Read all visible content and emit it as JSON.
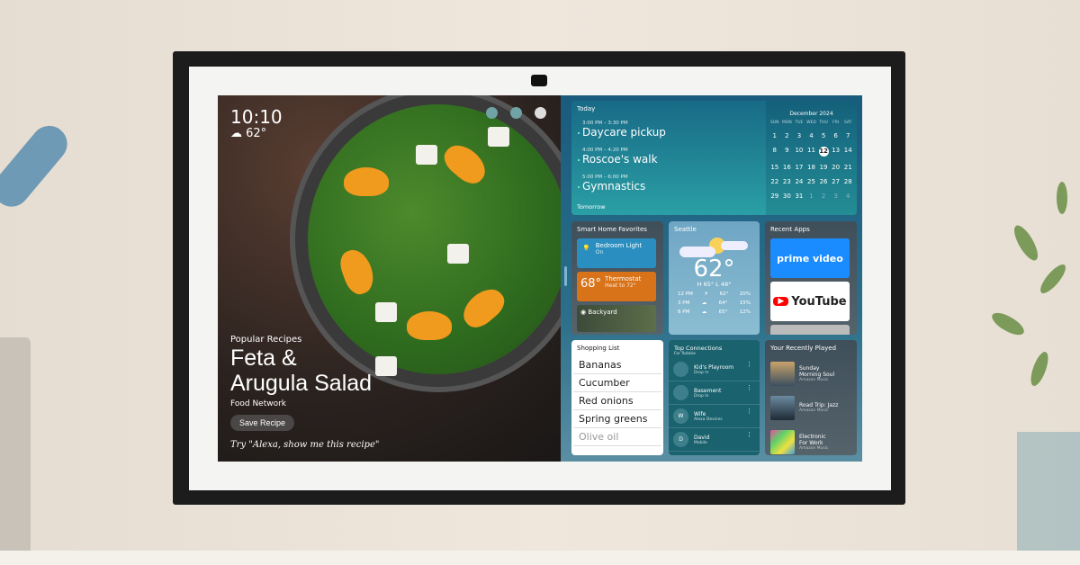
{
  "status": {
    "time": "10:10",
    "temp": "62°",
    "notification_count": "1"
  },
  "recipe": {
    "category": "Popular Recipes",
    "title_line1": "Feta &",
    "title_line2": "Arugula Salad",
    "source": "Food Network",
    "save_label": "Save Recipe",
    "hint": "Try \"Alexa, show me this recipe\""
  },
  "calendar": {
    "today_label": "Today",
    "tomorrow_label": "Tomorrow",
    "events": [
      {
        "time": "3:00 PM – 3:30 PM",
        "name": "Daycare pickup"
      },
      {
        "time": "4:00 PM – 4:20 PM",
        "name": "Roscoe's walk"
      },
      {
        "time": "5:00 PM – 6:00 PM",
        "name": "Gymnastics"
      }
    ],
    "month": "December 2024",
    "weekdays": [
      "SUN",
      "MON",
      "TUE",
      "WED",
      "THU",
      "FRI",
      "SAT"
    ],
    "days": [
      "1",
      "2",
      "3",
      "4",
      "5",
      "6",
      "7",
      "8",
      "9",
      "10",
      "11",
      "12",
      "13",
      "14",
      "15",
      "16",
      "17",
      "18",
      "19",
      "20",
      "21",
      "22",
      "23",
      "24",
      "25",
      "26",
      "27",
      "28",
      "29",
      "30",
      "31",
      "1",
      "2",
      "3",
      "4"
    ],
    "today": "12"
  },
  "smart_home": {
    "title": "Smart Home Favorites",
    "light": {
      "name": "Bedroom Light",
      "state": "On"
    },
    "thermostat": {
      "temp": "68°",
      "name": "Thermostat",
      "state": "Heat to 72°"
    },
    "camera": {
      "name": "Backyard"
    }
  },
  "weather": {
    "city": "Seattle",
    "temp": "62°",
    "high": "H 65°",
    "low": "L 48°",
    "forecast": [
      {
        "time": "12 PM",
        "icon": "sun-icon",
        "temp": "62°",
        "precip": "20%"
      },
      {
        "time": "3 PM",
        "icon": "cloud-icon",
        "temp": "64°",
        "precip": "15%"
      },
      {
        "time": "6 PM",
        "icon": "cloud-icon",
        "temp": "65°",
        "precip": "12%"
      }
    ]
  },
  "recent_apps": {
    "title": "Recent Apps",
    "apps": [
      "prime video",
      "YouTube"
    ]
  },
  "shopping": {
    "title": "Shopping List",
    "items": [
      "Bananas",
      "Cucumber",
      "Red onions",
      "Spring greens",
      "Olive oil"
    ]
  },
  "connections": {
    "title": "Top Connections",
    "subtitle": "For Robbie",
    "items": [
      {
        "initial": "",
        "name": "Kid's Playroom",
        "sub": "Drop In"
      },
      {
        "initial": "",
        "name": "Basement",
        "sub": "Drop In"
      },
      {
        "initial": "W",
        "name": "Wife",
        "sub": "Alexa Devices"
      },
      {
        "initial": "D",
        "name": "David",
        "sub": "Mobile"
      }
    ]
  },
  "played": {
    "title": "Your Recently Played",
    "items": [
      {
        "name_line1": "Sunday",
        "name_line2": "Morning Soul",
        "sub": "Amazon Music"
      },
      {
        "name_line1": "Road Trip: Jazz",
        "name_line2": "",
        "sub": "Amazon Music"
      },
      {
        "name_line1": "Electronic",
        "name_line2": "For Work",
        "sub": "Amazon Music"
      }
    ]
  },
  "colors": {
    "prime": "#1a8cff",
    "youtube_red": "#ff0000",
    "thermostat": "#d9731a",
    "light_tile": "#2a8fc0"
  }
}
